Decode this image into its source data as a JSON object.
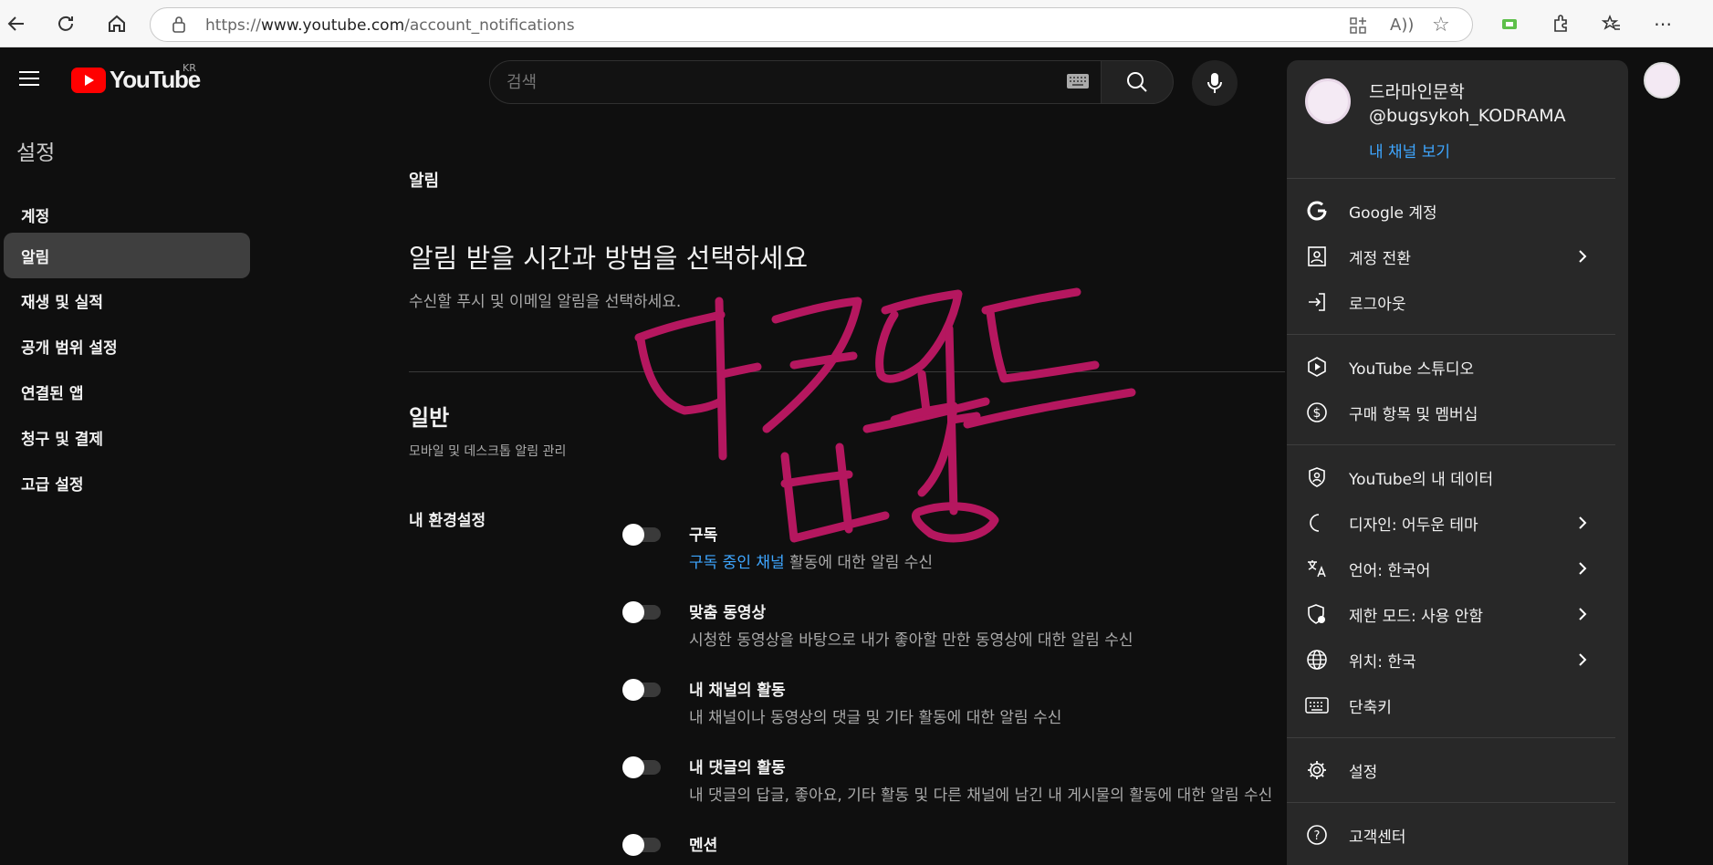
{
  "browser": {
    "url_prefix": "https://",
    "url_domain": "www.youtube.com",
    "url_path": "/account_notifications"
  },
  "header": {
    "logo_text": "YouTube",
    "country_code": "KR",
    "search_placeholder": "검색"
  },
  "sidebar": {
    "title": "설정",
    "items": [
      {
        "label": "계정"
      },
      {
        "label": "알림"
      },
      {
        "label": "재생 및 실적"
      },
      {
        "label": "공개 범위 설정"
      },
      {
        "label": "연결된 앱"
      },
      {
        "label": "청구 및 결제"
      },
      {
        "label": "고급 설정"
      }
    ]
  },
  "main": {
    "section_label": "알림",
    "heading": "알림 받을 시간과 방법을 선택하세요",
    "subheading": "수신할 푸시 및 이메일 알림을 선택하세요.",
    "general_title": "일반",
    "general_desc": "모바일 및 데스크톱 알림 관리",
    "prefs_label": "내 환경설정",
    "prefs": [
      {
        "title": "구독",
        "desc_link": "구독 중인 채널",
        "desc": " 활동에 대한 알림 수신"
      },
      {
        "title": "맞춤 동영상",
        "desc": "시청한 동영상을 바탕으로 내가 좋아할 만한 동영상에 대한 알림 수신"
      },
      {
        "title": "내 채널의 활동",
        "desc": "내 채널이나 동영상의 댓글 및 기타 활동에 대한 알림 수신"
      },
      {
        "title": "내 댓글의 활동",
        "desc": "내 댓글의 답글, 좋아요, 기타 활동 및 다른 채널에 남긴 내 게시물의 활동에 대한 알림 수신"
      },
      {
        "title": "멘션",
        "desc": ""
      }
    ]
  },
  "annotation": {
    "text": "다크모드 변경",
    "color": "#b5175f"
  },
  "account_menu": {
    "name": "드라마인문학",
    "handle": "@bugsykoh_KODRAMA",
    "view_channel": "내 채널 보기",
    "items": [
      {
        "label": "Google 계정",
        "icon": "google-icon"
      },
      {
        "label": "계정 전환",
        "icon": "switch-account-icon"
      },
      {
        "label": "로그아웃",
        "icon": "sign-out-icon"
      },
      {
        "label": "YouTube 스튜디오",
        "icon": "studio-icon"
      },
      {
        "label": "구매 항목 및 멤버십",
        "icon": "dollar-icon"
      },
      {
        "label": "YouTube의 내 데이터",
        "icon": "shield-person-icon"
      },
      {
        "label": "디자인: 어두운 테마",
        "icon": "moon-icon"
      },
      {
        "label": "언어: 한국어",
        "icon": "translate-icon"
      },
      {
        "label": "제한 모드: 사용 안함",
        "icon": "restricted-icon"
      },
      {
        "label": "위치: 한국",
        "icon": "globe-icon"
      },
      {
        "label": "단축키",
        "icon": "keyboard-icon"
      },
      {
        "label": "설정",
        "icon": "gear-icon"
      },
      {
        "label": "고객센터",
        "icon": "help-icon"
      }
    ]
  },
  "colors": {
    "background": "#0f0f0f",
    "menu_bg": "#282828",
    "link": "#3ea6ff",
    "brand_red": "#ff0000"
  }
}
